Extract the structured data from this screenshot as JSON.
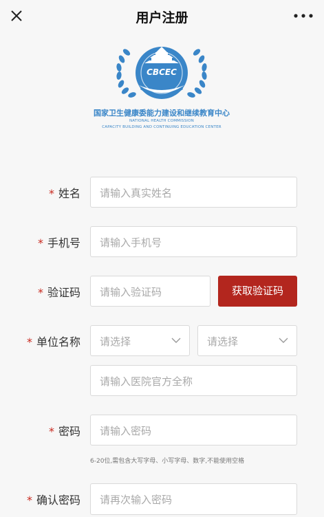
{
  "header": {
    "title": "用户注册"
  },
  "logo": {
    "emblem_text": "CBCEC",
    "org_name_cn": "国家卫生健康委能力建设和继续教育中心",
    "org_name_en_line1": "NATIONAL HEALTH COMMISSION",
    "org_name_en_line2": "CAPACITY BUILDING AND CONTINUING EDUCATION CENTER"
  },
  "form": {
    "required_mark": "*",
    "name": {
      "label": "姓名",
      "placeholder": "请输入真实姓名"
    },
    "phone": {
      "label": "手机号",
      "placeholder": "请输入手机号"
    },
    "code": {
      "label": "验证码",
      "placeholder": "请输入验证码",
      "button": "获取验证码"
    },
    "unit": {
      "label": "单位名称",
      "select1": "请选择",
      "select2": "请选择",
      "placeholder": "请输入医院官方全称"
    },
    "password": {
      "label": "密码",
      "placeholder": "请输入密码",
      "hint": "6-20位,需包含大写字母、小写字母、数字,不能使用空格"
    },
    "confirm": {
      "label": "确认密码",
      "placeholder": "请再次输入密码"
    }
  },
  "colors": {
    "accent": "#b3261e",
    "required": "#c8281e",
    "logo_blue": "#3a86c8"
  },
  "icons": [
    "close-icon",
    "more-icon",
    "chevron-down-icon"
  ]
}
